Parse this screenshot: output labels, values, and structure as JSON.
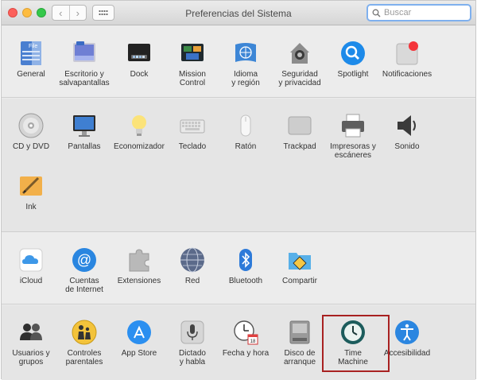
{
  "window": {
    "title": "Preferencias del Sistema",
    "search_placeholder": "Buscar"
  },
  "sections": [
    {
      "items": [
        {
          "label": "General",
          "icon": "general-icon"
        },
        {
          "label": "Escritorio y\nsalvapantallas",
          "icon": "desktop-screensaver-icon"
        },
        {
          "label": "Dock",
          "icon": "dock-icon"
        },
        {
          "label": "Mission\nControl",
          "icon": "mission-control-icon"
        },
        {
          "label": "Idioma\ny región",
          "icon": "language-region-icon"
        },
        {
          "label": "Seguridad\ny privacidad",
          "icon": "security-icon"
        },
        {
          "label": "Spotlight",
          "icon": "spotlight-icon"
        },
        {
          "label": "Notificaciones",
          "icon": "notifications-icon"
        }
      ]
    },
    {
      "items": [
        {
          "label": "CD y DVD",
          "icon": "cd-dvd-icon"
        },
        {
          "label": "Pantallas",
          "icon": "displays-icon"
        },
        {
          "label": "Economizador",
          "icon": "energy-saver-icon"
        },
        {
          "label": "Teclado",
          "icon": "keyboard-icon"
        },
        {
          "label": "Ratón",
          "icon": "mouse-icon"
        },
        {
          "label": "Trackpad",
          "icon": "trackpad-icon"
        },
        {
          "label": "Impresoras y\nescáneres",
          "icon": "printer-icon"
        },
        {
          "label": "Sonido",
          "icon": "sound-icon"
        },
        {
          "label": "Ink",
          "icon": "ink-icon"
        }
      ]
    },
    {
      "items": [
        {
          "label": "iCloud",
          "icon": "icloud-icon"
        },
        {
          "label": "Cuentas\nde Internet",
          "icon": "internet-accounts-icon"
        },
        {
          "label": "Extensiones",
          "icon": "extensions-icon"
        },
        {
          "label": "Red",
          "icon": "network-icon"
        },
        {
          "label": "Bluetooth",
          "icon": "bluetooth-icon"
        },
        {
          "label": "Compartir",
          "icon": "sharing-icon"
        }
      ]
    },
    {
      "items": [
        {
          "label": "Usuarios y\ngrupos",
          "icon": "users-groups-icon"
        },
        {
          "label": "Controles\nparentales",
          "icon": "parental-controls-icon"
        },
        {
          "label": "App Store",
          "icon": "app-store-icon"
        },
        {
          "label": "Dictado\ny habla",
          "icon": "dictation-icon"
        },
        {
          "label": "Fecha y hora",
          "icon": "date-time-icon"
        },
        {
          "label": "Disco de\narranque",
          "icon": "startup-disk-icon"
        },
        {
          "label": "Time\nMachine",
          "icon": "time-machine-icon"
        },
        {
          "label": "Accesibilidad",
          "icon": "accessibility-icon"
        }
      ]
    }
  ]
}
